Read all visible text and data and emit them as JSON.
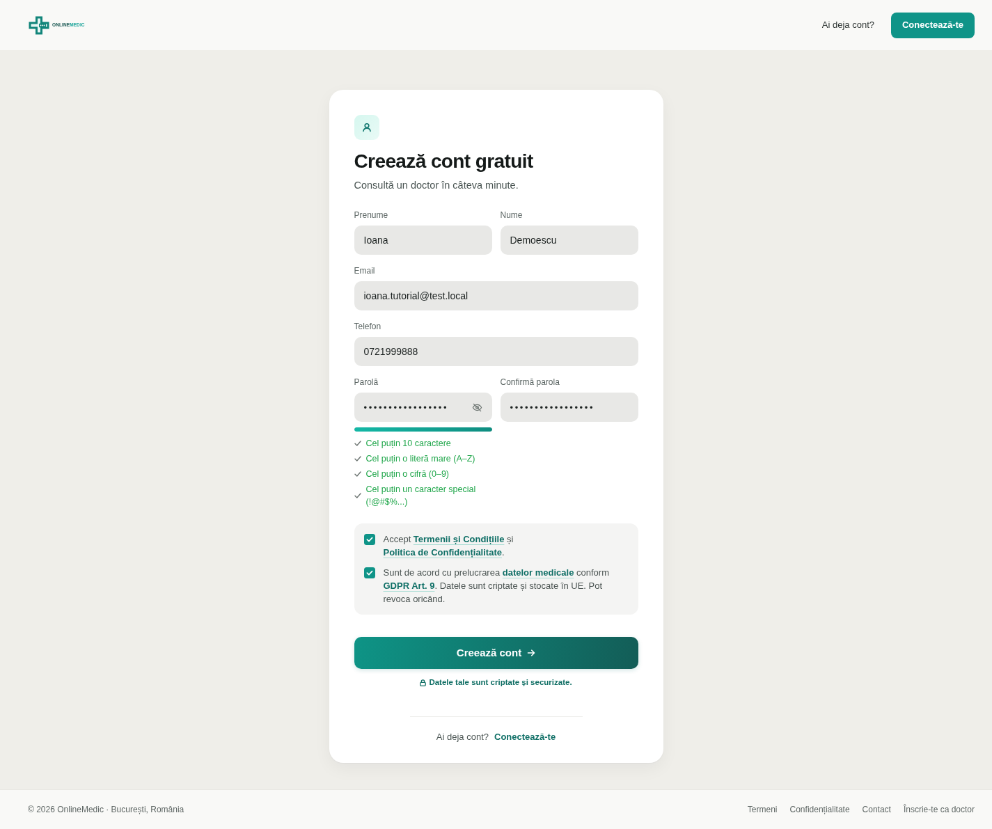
{
  "header": {
    "logo": {
      "wordmark_parts": [
        "ONLINE",
        "MEDIC"
      ]
    },
    "prompt": "Ai deja cont?",
    "login_button": "Conectează-te"
  },
  "form": {
    "title": "Creează cont gratuit",
    "subtitle": "Consultă un doctor în câteva minute.",
    "field_rows": [
      [
        {
          "label": "Prenume",
          "value": "Ioana"
        },
        {
          "label": "Nume",
          "value": "Demoescu"
        }
      ],
      [
        {
          "label": "Email",
          "value": "ioana.tutorial@test.local"
        }
      ],
      [
        {
          "label": "Telefon",
          "value": "0721999888"
        }
      ]
    ],
    "password": {
      "label": "Parolă",
      "value": "•••••••••••••••••",
      "strength": {
        "level": 1
      },
      "requirements": [
        {
          "text": "Cel puțin 10 caractere",
          "met": true
        },
        {
          "text": "Cel puțin o literă mare (A–Z)",
          "met": true
        },
        {
          "text": "Cel puțin o cifră (0–9)",
          "met": true
        },
        {
          "text": "Cel puțin un caracter special (!@#$%...)",
          "met": true
        }
      ]
    },
    "confirm_password": {
      "label": "Confirmă parola",
      "value": "•••••••••••••••••"
    },
    "consents": [
      {
        "checked": true,
        "parts": [
          {
            "kind": "text",
            "text": "Accept "
          },
          {
            "kind": "link",
            "text": "Termenii și Condițiile"
          },
          {
            "kind": "text",
            "text": " și "
          },
          {
            "kind": "link",
            "text": "Politica de Confidențialitate"
          },
          {
            "kind": "text",
            "text": "."
          }
        ]
      },
      {
        "checked": true,
        "parts": [
          {
            "kind": "text",
            "text": "Sunt de acord cu prelucrarea "
          },
          {
            "kind": "link",
            "text": "datelor medicale"
          },
          {
            "kind": "text",
            "text": " conform "
          },
          {
            "kind": "link",
            "text": "GDPR Art. 9"
          },
          {
            "kind": "text",
            "text": ". Datele sunt criptate și stocate în UE. Pot revoca oricând."
          }
        ]
      }
    ],
    "submit_button": "Creează cont",
    "security_note": "Datele tale sunt criptate și securizate.",
    "login_prompt": "Ai deja cont?",
    "login_link": "Conectează-te"
  },
  "footer": {
    "copyright": "© 2026 OnlineMedic · București, România",
    "links": [
      "Termeni",
      "Confidențialitate",
      "Contact",
      "Înscrie-te ca doctor"
    ]
  }
}
